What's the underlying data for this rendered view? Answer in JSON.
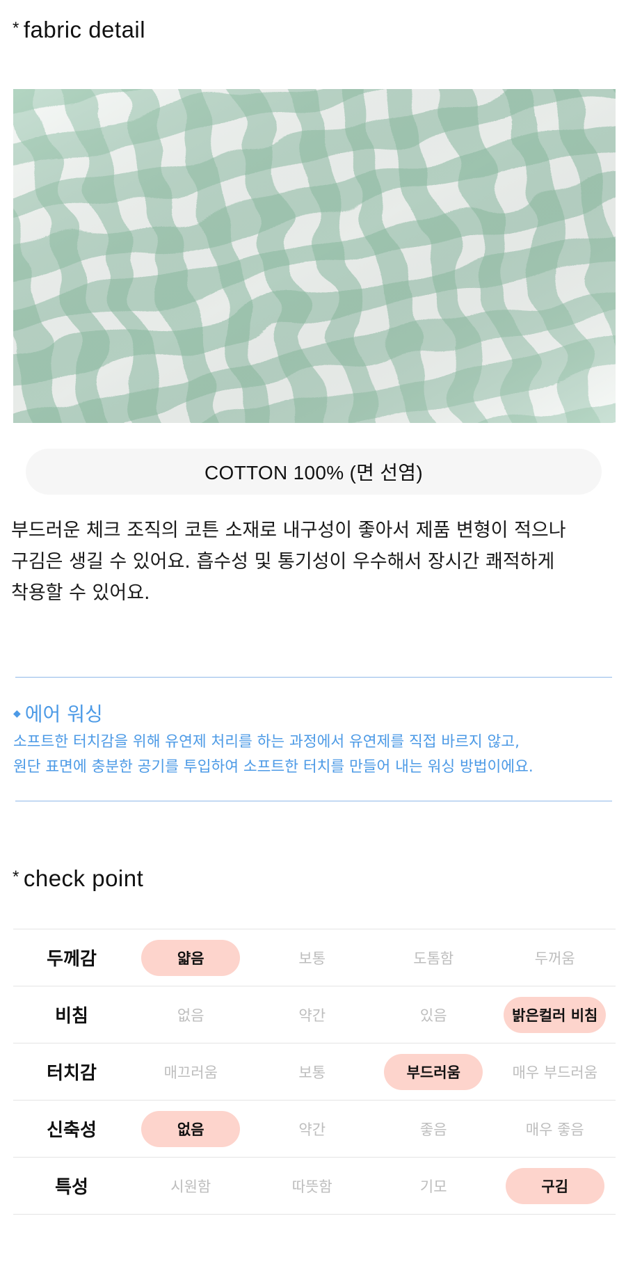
{
  "fabric_detail": {
    "title": "fabric detail",
    "spec": "COTTON 100% (면 선염)",
    "description": [
      "부드러운 체크 조직의 코튼 소재로 내구성이 좋아서 제품 변형이 적으나",
      "구김은 생길 수 있어요. 흡수성 및 통기성이 우수해서 장시간 쾌적하게",
      "착용할 수 있어요."
    ]
  },
  "air_washing": {
    "title": "에어 워싱",
    "lines": [
      "소프트한 터치감을 위해 유연제 처리를 하는 과정에서 유연제를 직접 바르지 않고,",
      "원단 표면에 충분한 공기를 투입하여 소프트한 터치를 만들어 내는 워싱 방법이에요."
    ]
  },
  "check_point": {
    "title": "check point",
    "rows": [
      {
        "label": "두께감",
        "options": [
          "얇음",
          "보통",
          "도톰함",
          "두꺼움"
        ],
        "selected": 0
      },
      {
        "label": "비침",
        "options": [
          "없음",
          "약간",
          "있음",
          "밝은컬러 비침"
        ],
        "selected": 3
      },
      {
        "label": "터치감",
        "options": [
          "매끄러움",
          "보통",
          "부드러움",
          "매우 부드러움"
        ],
        "selected": 2
      },
      {
        "label": "신축성",
        "options": [
          "없음",
          "약간",
          "좋음",
          "매우 좋음"
        ],
        "selected": 0
      },
      {
        "label": "특성",
        "options": [
          "시원함",
          "따뜻함",
          "기모",
          "구김"
        ],
        "selected": 3
      }
    ]
  },
  "colors": {
    "accent_blue": "#4c9ae6",
    "highlight_pill": "#fdd4cc",
    "fabric_green": "#8fc1a7"
  }
}
